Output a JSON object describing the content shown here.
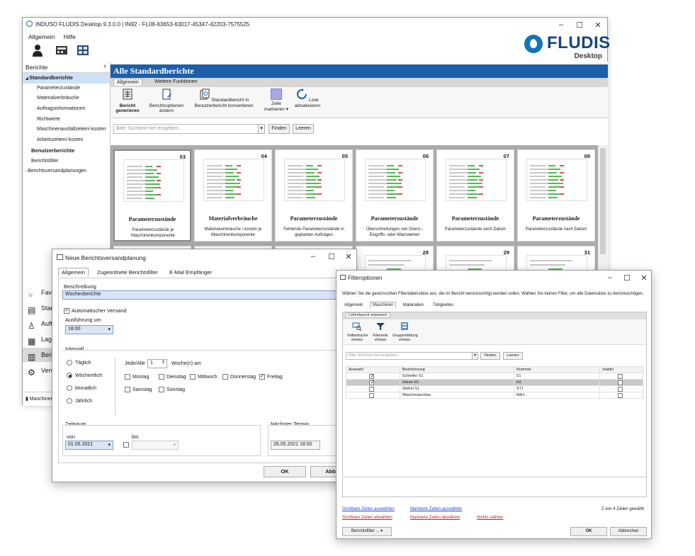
{
  "main_window": {
    "title": "INDUSO FLUDIS Desktop 9.3.0.0 | IN92 - FL08-63653-63017-45347-42203-7575525",
    "menu": [
      "Allgemein",
      "Hilfe"
    ],
    "logo_text": "FLUDIS",
    "logo_sub": "Desktop"
  },
  "sidebar": {
    "header": "Berichte",
    "tree": [
      {
        "label": "Standardberichte",
        "bold": true,
        "selected": true,
        "level": 0,
        "expanded": true
      },
      {
        "label": "Parameterzustände",
        "level": 2
      },
      {
        "label": "Materialverbräuche",
        "level": 2
      },
      {
        "label": "Auftragsinformationen",
        "level": 2
      },
      {
        "label": "Richtwerte",
        "level": 2
      },
      {
        "label": "Maschinenausfallzeiten/-kosten",
        "level": 2
      },
      {
        "label": "Arbeitszeiten/-kosten",
        "level": 2
      },
      {
        "label": "Benutzerberichte",
        "bold": true,
        "level": 1
      },
      {
        "label": "Berichtsfilter",
        "level": 1
      },
      {
        "label": "Berichtsversandplanungen",
        "level": 0,
        "collapsed": true
      }
    ],
    "nav": [
      "Favoriten",
      "Stammdaten",
      "Aufträge",
      "Lager",
      "Berichte",
      "Verwaltung"
    ],
    "status": "Maschinen"
  },
  "content": {
    "header": "Alle Standardberichte",
    "tabs": [
      "Allgemein",
      "Weitere Funktionen"
    ],
    "ribbon": [
      {
        "label": "Bericht\ngenerieren",
        "bold": true
      },
      {
        "label": "Berichtsoptionen\nändern"
      },
      {
        "label": "Standardbericht in\nBenutzerbericht konvertieren"
      },
      {
        "label": "Zeile\nmarkieren ▾"
      },
      {
        "label": "Liste\naktualisieren"
      }
    ],
    "search_placeholder": "Bitte Suchtext hier eingeben...",
    "find": "Finden",
    "clear": "Leeren",
    "cards": [
      {
        "num": "03",
        "title": "Parameterzustände",
        "desc": "Parameterzustände je Maschinenkomponente"
      },
      {
        "num": "04",
        "title": "Materialverbräuche",
        "desc": "Materialverbräuche /-kosten je Maschinenkomponente"
      },
      {
        "num": "05",
        "title": "Parameterzustände",
        "desc": "Fehlende Parameterzustände in geplanten Aufträgen"
      },
      {
        "num": "06",
        "title": "Parameterzustände",
        "desc": "Überschreitungen von Grenz-, Eingriffs- oder Warnwerten"
      },
      {
        "num": "07",
        "title": "Parameterzustände",
        "desc": "Parameterzustände nach Datum"
      },
      {
        "num": "08",
        "title": "Parameterzustände",
        "desc": "Parameterzustände nach Datum"
      }
    ],
    "cards_row2": [
      "09",
      "11",
      "26",
      "28",
      "29",
      "31"
    ]
  },
  "dialog1": {
    "title": "Neue Berichtsversandplanung",
    "tabs": [
      "Allgemein",
      "Zugeordnete Berichtsfilter",
      "E-Mail Empfänger"
    ],
    "beschreibung_label": "Beschreibung",
    "beschreibung_value": "Wochenberichte",
    "auto_versand": "Automatischer Versand",
    "ausfuehrung_label": "Ausführung um",
    "ausfuehrung_value": "18:00",
    "intervall_label": "Intervall",
    "intervall_options": [
      "Täglich",
      "Wöchentlich",
      "Monatlich",
      "Jährlich"
    ],
    "jede_label": "Jede/Alle",
    "jede_value": "1",
    "woche_label": "Woche(n) am",
    "days": [
      {
        "label": "Montag",
        "checked": false
      },
      {
        "label": "Dienstag",
        "checked": false
      },
      {
        "label": "Mittwoch",
        "checked": false
      },
      {
        "label": "Donnerstag",
        "checked": false
      },
      {
        "label": "Freitag",
        "checked": true
      },
      {
        "label": "Samstag",
        "checked": false
      },
      {
        "label": "Sonntag",
        "checked": false
      }
    ],
    "zeitraum_label": "Zeitraum",
    "von_label": "von",
    "von_value": "01.05.2021",
    "bis_label": "bis",
    "naechster_label": "Nächster Termin",
    "naechster_value": "28.05.2021 18:00",
    "ok": "OK",
    "cancel": "Abbr"
  },
  "dialog2": {
    "title": "Filteroptionen",
    "description": "Wählen Sie die gewünschten Filterdatensätze aus, die im Bericht berücksichtigt werden sollen. Wählen Sie keinen Filter, um alle Datensätze zu berücksichtigen.",
    "tabs": [
      "Allgemein",
      "Maschinen",
      "Materialien",
      "Tätigkeiten"
    ],
    "sub_tab": "Listenlayout anpassen",
    "ribbon": [
      "Volltextsuche\nein/aus",
      "Filterzeile\nein/aus",
      "Gruppenbildung\nein/aus"
    ],
    "search_placeholder": "Bitte Suchtext hier eingeben...",
    "find": "Finden",
    "clear": "Leeren",
    "columns": [
      "Auswahl",
      "Bezeichnung",
      "Nummer",
      "Inaktiv"
    ],
    "rows": [
      {
        "checked": true,
        "name": "Schleifer S1",
        "num": "S1",
        "selected": false
      },
      {
        "checked": true,
        "name": "Honer H1",
        "num": "H1",
        "selected": true
      },
      {
        "checked": false,
        "name": "Stößel S1",
        "num": "ST1",
        "selected": false
      },
      {
        "checked": false,
        "name": "Waschmaschine",
        "num": "WA1",
        "selected": false
      }
    ],
    "link_visible_select": "Sichtbare Zeilen auswählen",
    "link_visible_deselect": "Sichtbare Zeilen abwählen",
    "link_marked_select": "Markierte Zeilen auswählen",
    "link_marked_deselect": "Markierte Zeilen abwählen",
    "link_none": "Nichts wählen",
    "count": "2 von 4 Zeilen gewählt",
    "filter_button": "Berichtsfilter ...",
    "ok": "OK",
    "cancel": "Abbrechen"
  }
}
